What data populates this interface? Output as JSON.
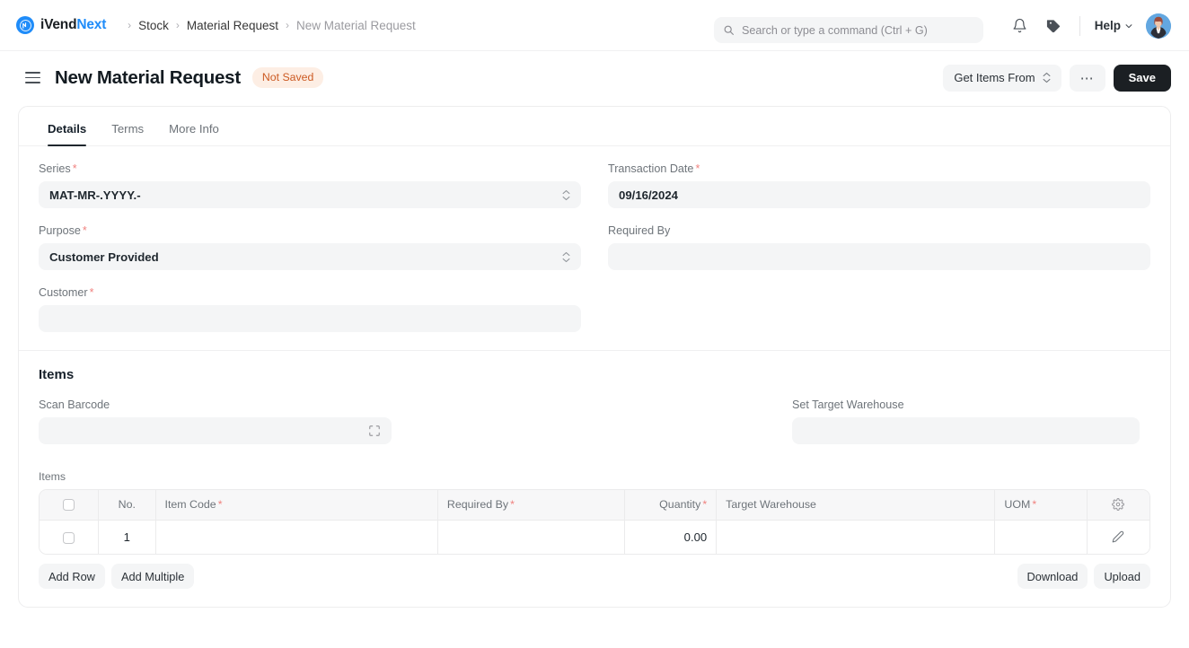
{
  "navbar": {
    "brand": {
      "part1": "iVend",
      "part2": "Next",
      "logo_icon": "ivend-logo-icon"
    },
    "breadcrumbs": [
      {
        "label": "Stock",
        "muted": false
      },
      {
        "label": "Material Request",
        "muted": false
      },
      {
        "label": "New Material Request",
        "muted": true
      }
    ],
    "separator": "›",
    "search": {
      "placeholder": "Search or type a command (Ctrl + G)",
      "value": "",
      "icon": "search-icon"
    },
    "notifications_icon": "bell-icon",
    "tags_icon": "tag-icon",
    "help": {
      "label": "Help",
      "chevron": "chevron-down-icon"
    },
    "avatar_icon": "user-avatar"
  },
  "pagehead": {
    "menu_icon": "hamburger-menu-icon",
    "title": "New Material Request",
    "status_badge": "Not Saved",
    "get_items_from": "Get Items From",
    "more_actions": "⋯",
    "save_label": "Save"
  },
  "tabs": [
    {
      "label": "Details",
      "active": true
    },
    {
      "label": "Terms",
      "active": false
    },
    {
      "label": "More Info",
      "active": false
    }
  ],
  "details": {
    "series": {
      "label": "Series",
      "required": true,
      "value": "MAT-MR-.YYYY.-",
      "type": "select"
    },
    "transaction_date": {
      "label": "Transaction Date",
      "required": true,
      "value": "09/16/2024",
      "type": "date"
    },
    "purpose": {
      "label": "Purpose",
      "required": true,
      "value": "Customer Provided",
      "type": "select"
    },
    "required_by": {
      "label": "Required By",
      "required": false,
      "value": "",
      "type": "date"
    },
    "customer": {
      "label": "Customer",
      "required": true,
      "value": "",
      "type": "link"
    }
  },
  "items_section": {
    "heading": "Items",
    "scan_barcode": {
      "label": "Scan Barcode",
      "value": "",
      "icon": "barcode-scan-icon"
    },
    "set_target_warehouse": {
      "label": "Set Target Warehouse",
      "value": ""
    },
    "grid_label": "Items",
    "columns": [
      {
        "key": "check",
        "label": "",
        "icon": "select-all-checkbox"
      },
      {
        "key": "no",
        "label": "No.",
        "required": false
      },
      {
        "key": "item_code",
        "label": "Item Code",
        "required": true
      },
      {
        "key": "required_by",
        "label": "Required By",
        "required": true
      },
      {
        "key": "quantity",
        "label": "Quantity",
        "required": true
      },
      {
        "key": "target_warehouse",
        "label": "Target Warehouse",
        "required": false
      },
      {
        "key": "uom",
        "label": "UOM",
        "required": true
      },
      {
        "key": "settings",
        "label": "",
        "icon": "gear-icon"
      }
    ],
    "rows": [
      {
        "no": "1",
        "item_code": "",
        "required_by": "",
        "quantity": "0.00",
        "target_warehouse": "",
        "uom": "",
        "edit_icon": "pencil-icon"
      }
    ],
    "footer": {
      "add_row": "Add Row",
      "add_multiple": "Add Multiple",
      "download": "Download",
      "upload": "Upload"
    }
  },
  "colors": {
    "accent_blue": "#1f8cf9",
    "badge_bg": "#fdeee4",
    "badge_text": "#cc5a22",
    "required_asterisk": "#f0817e",
    "control_bg": "#f4f5f6",
    "save_button_bg": "#1b1f23"
  }
}
